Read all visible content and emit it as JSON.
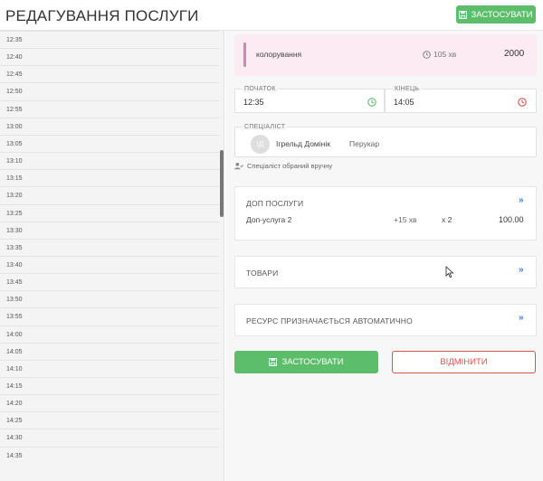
{
  "header": {
    "title": "РЕДАГУВАННЯ ПОСЛУГИ",
    "apply_label": "ЗАСТОСУВАТИ"
  },
  "schedule": {
    "times": [
      "12:35",
      "12:40",
      "12:45",
      "12:50",
      "12:55",
      "13:00",
      "13:05",
      "13:10",
      "13:15",
      "13:20",
      "13:25",
      "13:30",
      "13:35",
      "13:40",
      "13:45",
      "13:50",
      "13:55",
      "14:00",
      "14:05",
      "14:10",
      "14:15",
      "14:20",
      "14:25",
      "14:30",
      "14:35"
    ]
  },
  "service": {
    "name": "колорування",
    "duration": "105 хв",
    "price": "2000",
    "accent_color": "#c98ab4"
  },
  "time_fields": {
    "start_label": "ПОЧАТОК",
    "start_value": "12:35",
    "end_label": "КІНЕЦЬ",
    "end_value": "14:05"
  },
  "specialist": {
    "label": "СПЕЦІАЛІСТ",
    "initials": "ІД",
    "name": "Ігрельд Домінік",
    "role": "Перукар",
    "note": "Спеціаліст обраний вручну"
  },
  "addons": {
    "title": "ДОП ПОСЛУГИ",
    "items": [
      {
        "name": "Доп-услуга 2",
        "time": "+15 хв",
        "qty": "x 2",
        "price": "100.00"
      }
    ]
  },
  "goods": {
    "title": "ТОВАРИ"
  },
  "resource": {
    "title": "РЕСУРС ПРИЗНАЧАЄТЬСЯ АВТОМАТИЧНО"
  },
  "actions": {
    "apply_label": "ЗАСТОСУВАТИ",
    "cancel_label": "ВІДМІНИТИ"
  },
  "colors": {
    "primary_green": "#5cbe6a",
    "danger_red": "#d9534f",
    "link_blue": "#3b7dd8"
  }
}
